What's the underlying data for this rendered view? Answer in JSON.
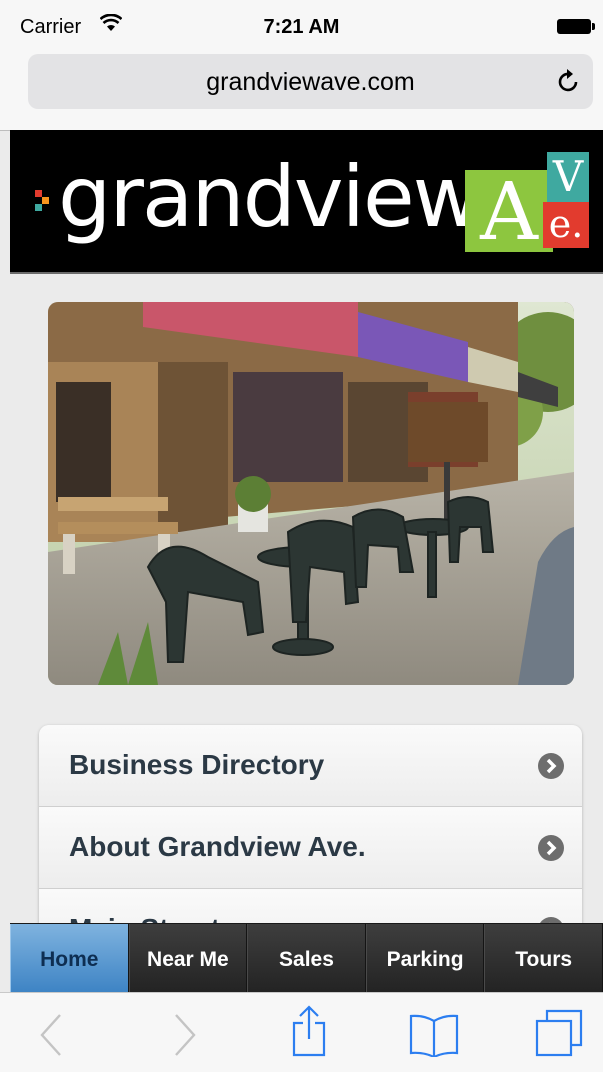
{
  "status_bar": {
    "carrier": "Carrier",
    "time": "7:21 AM",
    "wifi_icon": "wifi-icon",
    "battery_icon": "battery-icon"
  },
  "browser": {
    "url": "grandviewave.com",
    "reload_icon": "reload-icon"
  },
  "site_header": {
    "logo_text": "grandview",
    "logo_mark": {
      "a": "A",
      "v": "V",
      "e": "e."
    }
  },
  "hero": {
    "image": "storefront-patio-photo"
  },
  "menu": {
    "items": [
      {
        "label": "Business Directory"
      },
      {
        "label": "About Grandview Ave."
      },
      {
        "label": "Main Street"
      }
    ],
    "chevron_icon": "chevron-right-icon"
  },
  "tabbar": {
    "tabs": [
      {
        "label": "Home",
        "active": true
      },
      {
        "label": "Near Me",
        "active": false
      },
      {
        "label": "Sales",
        "active": false
      },
      {
        "label": "Parking",
        "active": false
      },
      {
        "label": "Tours",
        "active": false
      }
    ]
  },
  "toolbar": {
    "icons": [
      "back-icon",
      "forward-icon",
      "share-icon",
      "bookmarks-icon",
      "tabs-icon"
    ]
  },
  "colors": {
    "tab_active": "#5a9bd5",
    "header_bg": "#000000",
    "menu_text": "#2b3945",
    "logo_green": "#8dc63f",
    "logo_teal": "#3fa9a0",
    "logo_red": "#e23b2e"
  }
}
